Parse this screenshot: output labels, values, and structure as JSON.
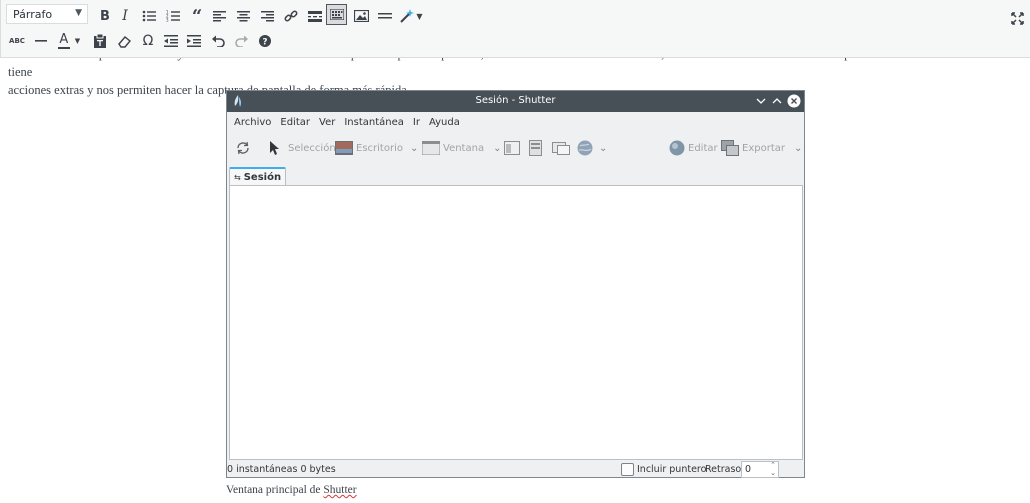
{
  "editor": {
    "format_select": "Párrafo",
    "toolbar_row1": [
      "bold-icon",
      "italic-icon",
      "bullet-list-icon",
      "numbered-list-icon",
      "blockquote-icon",
      "align-left-icon",
      "align-center-icon",
      "align-right-icon",
      "link-icon",
      "read-more-icon",
      "toolbar-toggle-icon",
      "insert-image-icon",
      "horizontal-line-icon",
      "magic-wand-icon"
    ],
    "toolbar_row2": [
      "strikethrough-icon",
      "horizontal-rule-icon",
      "text-color-icon",
      "paste-text-icon",
      "clear-formatting-icon",
      "special-character-icon",
      "outdent-icon",
      "indent-icon",
      "undo-icon",
      "redo-icon",
      "help-icon"
    ],
    "bold_label": "B",
    "italic_label": "I",
    "omega_label": "Ω",
    "abc_label": "ABC",
    "text_color_label": "A"
  },
  "article": {
    "line1": "La ventana de la aplicación es muy sencilla. Podemos hacer varios tipos de captura de pantalla, bien seleccionado un área concreta, un escritorio o una ventana. Cada opción de la barra de herramientas tiene",
    "line2": "acciones extras y nos permiten hacer la captura de pantalla de forma más rápida."
  },
  "shutter": {
    "title": "Sesión - Shutter",
    "menu": [
      "Archivo",
      "Editar",
      "Ver",
      "Instantánea",
      "Ir",
      "Ayuda"
    ],
    "toolbar": {
      "seleccion": "Selección",
      "escritorio": "Escritorio",
      "ventana": "Ventana",
      "editar": "Editar",
      "exportar": "Exportar"
    },
    "tab": "Sesión",
    "status": {
      "left": "0 instantáneas  0 bytes",
      "include_pointer": "Incluir puntero",
      "delay_label": "Retraso:",
      "delay_value": "0"
    },
    "colors": {
      "titlebar": "#475057",
      "tab_accent": "#3daee9"
    }
  },
  "caption": {
    "prefix": "Ventana principal de ",
    "name": "Shutter"
  }
}
